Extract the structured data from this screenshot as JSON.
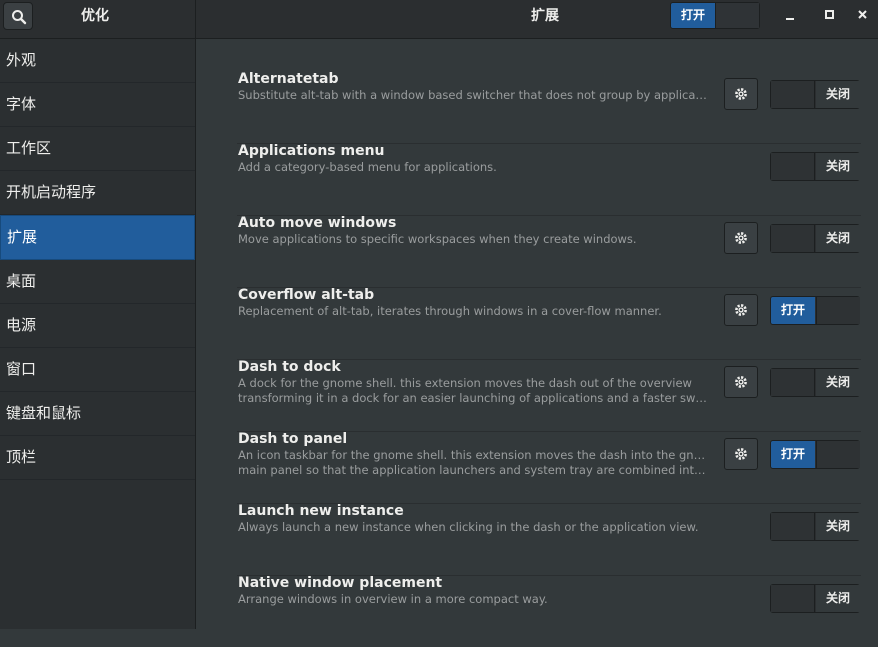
{
  "header": {
    "app_title": "优化",
    "page_title": "扩展",
    "global_switch_label": "打开"
  },
  "sidebar": {
    "items": [
      {
        "label": "外观"
      },
      {
        "label": "字体"
      },
      {
        "label": "工作区"
      },
      {
        "label": "开机启动程序"
      },
      {
        "label": "扩展",
        "active": true
      },
      {
        "label": "桌面"
      },
      {
        "label": "电源"
      },
      {
        "label": "窗口"
      },
      {
        "label": "键盘和鼠标"
      },
      {
        "label": "顶栏"
      }
    ]
  },
  "extensions": [
    {
      "title": "Alternatetab",
      "desc1": "Substitute alt-tab with a window based switcher that does not group by application.",
      "desc2": "",
      "has_settings": true,
      "state": "关闭",
      "on": false
    },
    {
      "title": "Applications menu",
      "desc1": "Add a category-based menu for applications.",
      "desc2": "",
      "has_settings": false,
      "state": "关闭",
      "on": false
    },
    {
      "title": "Auto move windows",
      "desc1": "Move applications to specific workspaces when they create windows.",
      "desc2": "",
      "has_settings": true,
      "state": "关闭",
      "on": false
    },
    {
      "title": "Coverflow alt-tab",
      "desc1": "Replacement of alt-tab, iterates through windows in a cover-flow manner.",
      "desc2": "",
      "has_settings": true,
      "state": "打开",
      "on": true
    },
    {
      "title": "Dash to dock",
      "desc1": "A dock for the gnome shell. this extension moves the dash out of the overview",
      "desc2": "transforming it in a dock for an easier launching of applications and a faster switch…",
      "has_settings": true,
      "state": "关闭",
      "on": false
    },
    {
      "title": "Dash to panel",
      "desc1": "An icon taskbar for the gnome shell. this extension moves the dash into the gnome",
      "desc2": "main panel so that the application launchers and system tray are combined into a s…",
      "has_settings": true,
      "state": "打开",
      "on": true
    },
    {
      "title": "Launch new instance",
      "desc1": "Always launch a new instance when clicking in the dash or the application view.",
      "desc2": "",
      "has_settings": false,
      "state": "关闭",
      "on": false
    },
    {
      "title": "Native window placement",
      "desc1": "Arrange windows in overview in a more compact way.",
      "desc2": "",
      "has_settings": false,
      "state": "关闭",
      "on": false
    }
  ],
  "colors": {
    "accent": "#215d9c",
    "background": "#33393b",
    "sidebar": "#2b2f31",
    "header": "#2b2e30"
  },
  "icons": {
    "search": "search-icon",
    "settings": "gear-icon",
    "minimize": "minimize-icon",
    "maximize": "maximize-icon",
    "close": "close-icon"
  }
}
